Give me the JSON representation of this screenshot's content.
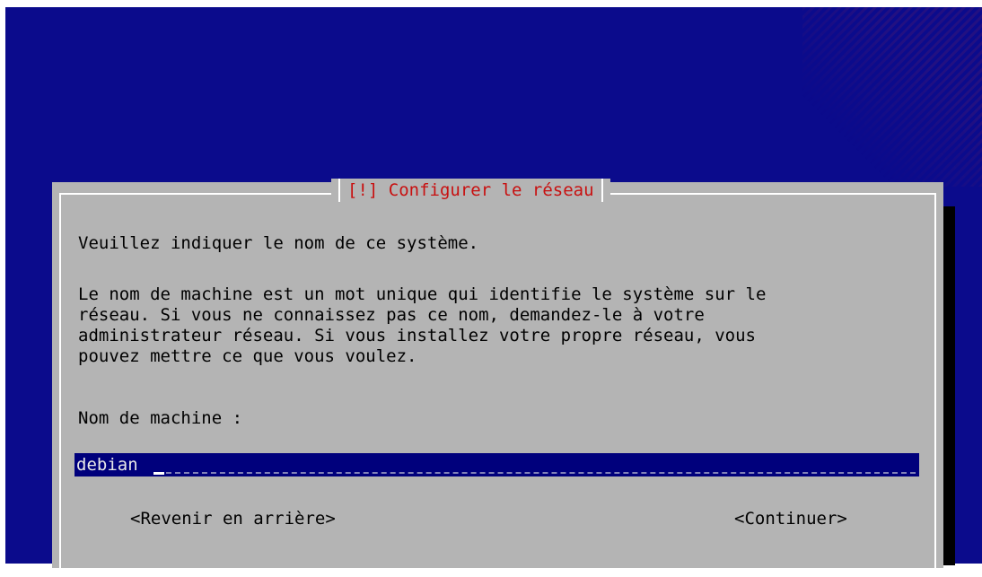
{
  "dialog": {
    "title": "[!] Configurer le réseau",
    "question": "Veuillez indiquer le nom de ce système.",
    "description_lines": [
      "Le nom de machine est un mot unique qui identifie le système sur le",
      "réseau. Si vous ne connaissez pas ce nom, demandez-le à votre",
      "administrateur réseau. Si vous installez votre propre réseau, vous",
      "pouvez mettre ce que vous voulez."
    ],
    "field_label": "Nom de machine :",
    "hostname_value": "debian",
    "back_button": "<Revenir en arrière>",
    "continue_button": "<Continuer>"
  },
  "colors": {
    "background": "#0b0b8c",
    "dialog": "#b4b4b4",
    "title": "#c81010",
    "input": "#00007c"
  }
}
